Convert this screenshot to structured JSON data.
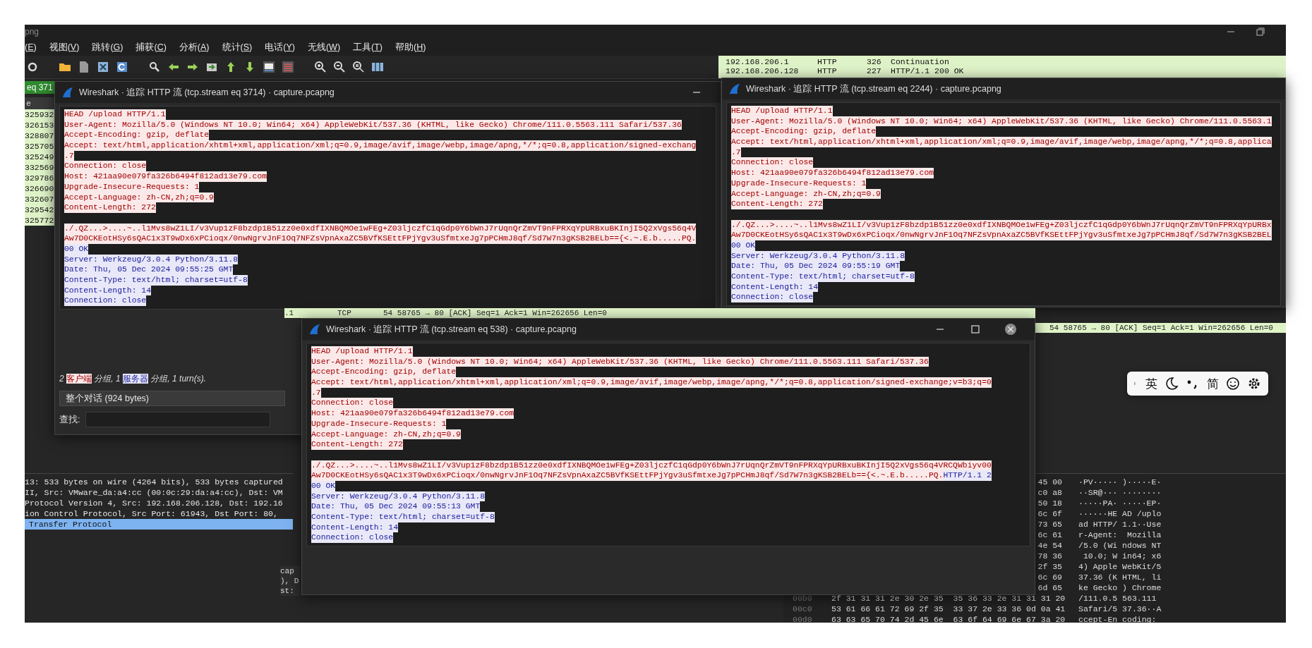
{
  "main_window": {
    "title": "png",
    "menu": [
      "(E)",
      "视图(V)",
      "跳转(G)",
      "捕获(C)",
      "分析(A)",
      "统计(S)",
      "电话(Y)",
      "无线(W)",
      "工具(T)",
      "帮助(H)"
    ],
    "packet_rows": [
      {
        "source": "192.168.206.1",
        "protocol": "HTTP",
        "length": "326",
        "info": "Continuation"
      },
      {
        "source": "192.168.206.128",
        "protocol": "HTTP",
        "length": "227",
        "info": "HTTP/1.1 200 OK"
      }
    ],
    "filter": "eq 371",
    "packet_numbers": {
      "header": "e",
      "rows": [
        "325932",
        "326153",
        "328807",
        "325705",
        "325249",
        "332569",
        "329786",
        "326690",
        "332607",
        "329542",
        "325772"
      ]
    },
    "ack_rows": [
      {
        "column_1": ".1",
        "protocol": "TCP",
        "info": "54 58765 → 80 [ACK] Seq=1 Ack=1 Win=262656 Len=0"
      },
      {
        "info": "54 58765 → 80 [ACK] Seq=1 Ack=1 Win=262656 Len=0"
      }
    ],
    "details": [
      {
        "text": "13: 533 bytes on wire (4264 bits), 533 bytes captured",
        "selected": false
      },
      {
        "text": "II, Src: VMware_da:a4:cc (00:0c:29:da:a4:cc), Dst: VM",
        "selected": false
      },
      {
        "text": "Protocol Version 4, Src: 192.168.206.128, Dst: 192.16",
        "selected": false
      },
      {
        "text": "ion Control Protocol, Src Port: 61943, Dst Port: 80,",
        "selected": false
      },
      {
        "text": "Transfer Protocol",
        "selected": true
      }
    ],
    "details_fragments": [
      "cap",
      "), D",
      "st:"
    ],
    "hex_rows": [
      {
        "hex": "45 00",
        "ascii": "·PV····· )·····E·"
      },
      {
        "hex": "c0 a8",
        "ascii": "··SR@··· ········"
      },
      {
        "hex": "50 18",
        "ascii": "·····PA· ·····EP·"
      },
      {
        "hex": "6c 6f",
        "ascii": "······HE AD /uplo"
      },
      {
        "hex": "73 65",
        "ascii": "ad HTTP/ 1.1··Use"
      },
      {
        "hex": "6c 61",
        "ascii": "r-Agent:  Mozilla"
      },
      {
        "hex": "4e 54",
        "ascii": "/5.0 (Wi ndows NT"
      },
      {
        "hex": "78 36",
        "ascii": " 10.0; W in64; x6"
      },
      {
        "hex": "2f 35",
        "ascii": "4) Apple WebKit/5"
      },
      {
        "hex": "6c 69",
        "ascii": "37.36 (K HTML, li"
      },
      {
        "hex": "6d 65",
        "ascii": "ke Gecko ) Chrome"
      },
      {
        "offset": "00b0",
        "hex": "2f 31 31 31 2e 30 2e 35  35 36 33 2e 31 31 31 20",
        "ascii": "/111.0.5 563.111"
      },
      {
        "offset": "00c0",
        "hex": "53 61 66 61 72 69 2f 35  33 37 2e 33 36 0d 0a 41",
        "ascii": "Safari/5 37.36··A"
      },
      {
        "offset": "00d0",
        "hex": "63 63 65 70 74 2d 45 6e  63 6f 64 69 6e 67 3a 20",
        "ascii": "ccept-En coding:"
      }
    ]
  },
  "stream_windows": [
    {
      "title": "Wireshark · 追踪 HTTP 流 (tcp.stream eq 3714) · capture.pcapng",
      "controls": [
        {
          "kind": "minimize"
        }
      ],
      "lines": [
        {
          "parts": [
            {
              "kind": "request",
              "text": "HEAD /upload HTTP/1.1"
            }
          ]
        },
        {
          "parts": [
            {
              "kind": "request",
              "text": "User-Agent: Mozilla/5.0 (Windows NT 10.0; Win64; x64) AppleWebKit/537.36 (KHTML, like Gecko) Chrome/111.0.5563.111 Safari/537.36"
            }
          ]
        },
        {
          "parts": [
            {
              "kind": "request",
              "text": "Accept-Encoding: gzip, deflate"
            }
          ]
        },
        {
          "parts": [
            {
              "kind": "request",
              "text": "Accept: text/html,application/xhtml+xml,application/xml;q=0.9,image/avif,image/webp,image/apng,*/*;q=0.8,application/signed-exchang"
            }
          ]
        },
        {
          "parts": [
            {
              "kind": "request",
              "text": ".7"
            }
          ]
        },
        {
          "parts": [
            {
              "kind": "request",
              "text": "Connection: close"
            }
          ]
        },
        {
          "parts": [
            {
              "kind": "request",
              "text": "Host: 421aa90e079fa326b6494f812ad13e79.com"
            }
          ]
        },
        {
          "parts": [
            {
              "kind": "request",
              "text": "Upgrade-Insecure-Requests: 1"
            }
          ]
        },
        {
          "parts": [
            {
              "kind": "request",
              "text": "Accept-Language: zh-CN,zh;q=0.9"
            }
          ]
        },
        {
          "parts": [
            {
              "kind": "request",
              "text": "Content-Length: 272"
            }
          ]
        },
        {
          "gap_before": true,
          "parts": [
            {
              "kind": "request",
              "text": "./.QZ...>....~..l1Mvs8wZ1LI/v3Vup1zF8bzdp1B51zz0e0xdfIXNBQMOe1wFEg+Z03ljczfC1qGdp0Y6bWnJ7rUqnQrZmVT9nFPRXqYpURBxuBKInjI5Q2xVgs56q4V"
            }
          ]
        },
        {
          "parts": [
            {
              "kind": "request",
              "text": "Aw7D0CKEotHSy6sQAC1x3T9wDx6xPCioqx/0nwNgrvJnF1Oq7NFZsVpnAxaZC5BVfKSEttFPjYgv3uSfmtxeJg7pPCHmJ8qf/Sd7W7n3gKSB2BELb=={<.~.E.b.....PQ."
            }
          ]
        },
        {
          "parts": [
            {
              "kind": "response",
              "text": "00 OK"
            }
          ]
        },
        {
          "parts": [
            {
              "kind": "response",
              "text": "Server: Werkzeug/3.0.4 Python/3.11.8"
            }
          ]
        },
        {
          "parts": [
            {
              "kind": "response",
              "text": "Date: Thu, 05 Dec 2024 09:55:25 GMT"
            }
          ]
        },
        {
          "parts": [
            {
              "kind": "response",
              "text": "Content-Type: text/html; charset=utf-8"
            }
          ]
        },
        {
          "parts": [
            {
              "kind": "response",
              "text": "Content-Length: 14"
            }
          ]
        },
        {
          "parts": [
            {
              "kind": "response",
              "text": "Connection: close"
            }
          ]
        }
      ],
      "footer": {
        "summary": [
          {
            "text": "2 "
          },
          {
            "kind": "request",
            "text": "客户端"
          },
          {
            "text": " 分组, 1 "
          },
          {
            "kind": "response",
            "text": "服务器"
          },
          {
            "text": " 分组, 1 turn(s)."
          }
        ],
        "conversation": "整个对话 (924 bytes)",
        "find_label": "查找:"
      }
    },
    {
      "title": "Wireshark · 追踪 HTTP 流 (tcp.stream eq 2244) · capture.pcapng",
      "lines": [
        {
          "parts": [
            {
              "kind": "request",
              "text": "HEAD /upload HTTP/1.1"
            }
          ]
        },
        {
          "parts": [
            {
              "kind": "request",
              "text": "User-Agent: Mozilla/5.0 (Windows NT 10.0; Win64; x64) AppleWebKit/537.36 (KHTML, like Gecko) Chrome/111.0.5563.1"
            }
          ]
        },
        {
          "parts": [
            {
              "kind": "request",
              "text": "Accept-Encoding: gzip, deflate"
            }
          ]
        },
        {
          "parts": [
            {
              "kind": "request",
              "text": "Accept: text/html,application/xhtml+xml,application/xml;q=0.9,image/avif,image/webp,image/apng,*/*;q=0.8,applica"
            }
          ]
        },
        {
          "parts": [
            {
              "kind": "request",
              "text": ".7"
            }
          ]
        },
        {
          "parts": [
            {
              "kind": "request",
              "text": "Connection: close"
            }
          ]
        },
        {
          "parts": [
            {
              "kind": "request",
              "text": "Host: 421aa90e079fa326b6494f812ad13e79.com"
            }
          ]
        },
        {
          "parts": [
            {
              "kind": "request",
              "text": "Upgrade-Insecure-Requests: 1"
            }
          ]
        },
        {
          "parts": [
            {
              "kind": "request",
              "text": "Accept-Language: zh-CN,zh;q=0.9"
            }
          ]
        },
        {
          "parts": [
            {
              "kind": "request",
              "text": "Content-Length: 272"
            }
          ]
        },
        {
          "gap_before": true,
          "parts": [
            {
              "kind": "request",
              "text": "./.QZ...>....~..l1Mvs8wZ1LI/v3Vup1zF8bzdp1B51zz0e0xdfIXNBQMOe1wFEg+Z03ljczfC1qGdp0Y6bWnJ7rUqnQrZmVT9nFPRXqYpURBx"
            }
          ]
        },
        {
          "parts": [
            {
              "kind": "request",
              "text": "Aw7D0CKEotHSy6sQAC1x3T9wDx6xPCioqx/0nwNgrvJnF1Oq7NFZsVpnAxaZC5BVfKSEttFPjYgv3uSfmtxeJg7pPCHmJ8qf/Sd7W7n3gKSB2BEL"
            }
          ]
        },
        {
          "parts": [
            {
              "kind": "response",
              "text": "00 OK"
            }
          ]
        },
        {
          "parts": [
            {
              "kind": "response",
              "text": "Server: Werkzeug/3.0.4 Python/3.11.8"
            }
          ]
        },
        {
          "parts": [
            {
              "kind": "response",
              "text": "Date: Thu, 05 Dec 2024 09:55:19 GMT"
            }
          ]
        },
        {
          "parts": [
            {
              "kind": "response",
              "text": "Content-Type: text/html; charset=utf-8"
            }
          ]
        },
        {
          "parts": [
            {
              "kind": "response",
              "text": "Content-Length: 14"
            }
          ]
        },
        {
          "parts": [
            {
              "kind": "response",
              "text": "Connection: close"
            }
          ]
        }
      ]
    },
    {
      "title": "Wireshark · 追踪 HTTP 流 (tcp.stream eq 538) · capture.pcapng",
      "controls": [
        {
          "kind": "minimize"
        },
        {
          "kind": "maximize"
        },
        {
          "kind": "close"
        }
      ],
      "lines": [
        {
          "parts": [
            {
              "kind": "request",
              "text": "HEAD /upload HTTP/1.1"
            }
          ]
        },
        {
          "parts": [
            {
              "kind": "request",
              "text": "User-Agent: Mozilla/5.0 (Windows NT 10.0; Win64; x64) AppleWebKit/537.36 (KHTML, like Gecko) Chrome/111.0.5563.111 Safari/537.36"
            }
          ]
        },
        {
          "parts": [
            {
              "kind": "request",
              "text": "Accept-Encoding: gzip, deflate"
            }
          ]
        },
        {
          "parts": [
            {
              "kind": "request",
              "text": "Accept: text/html,application/xhtml+xml,application/xml;q=0.9,image/avif,image/webp,image/apng,*/*;q=0.8,application/signed-exchange;v=b3;q=0"
            }
          ]
        },
        {
          "parts": [
            {
              "kind": "request",
              "text": ".7"
            }
          ]
        },
        {
          "parts": [
            {
              "kind": "request",
              "text": "Connection: close"
            }
          ]
        },
        {
          "parts": [
            {
              "kind": "request",
              "text": "Host: 421aa90e079fa326b6494f812ad13e79.com"
            }
          ]
        },
        {
          "parts": [
            {
              "kind": "request",
              "text": "Upgrade-Insecure-Requests: 1"
            }
          ]
        },
        {
          "parts": [
            {
              "kind": "request",
              "text": "Accept-Language: zh-CN,zh;q=0.9"
            }
          ]
        },
        {
          "parts": [
            {
              "kind": "request",
              "text": "Content-Length: 272"
            }
          ]
        },
        {
          "gap_before": true,
          "parts": [
            {
              "kind": "request",
              "text": "./.QZ...>....~..l1Mvs8wZ1LI/v3Vup1zF8bzdp1B51zz0e0xdfIXNBQMOe1wFEg+Z03ljczfC1qGdp0Y6bWnJ7rUqnQrZmVT9nFPRXqYpURBxuBKInjI5Q2xVgs56q4VRCQWbiyv00"
            }
          ]
        },
        {
          "parts": [
            {
              "kind": "request",
              "text": "Aw7D0CKEotHSy6sQAC1x3T9wDx6xPCioqx/0nwNgrvJnF1Oq7NFZsVpnAxaZC5BVfKSEttFPjYgv3uSfmtxeJg7pPCHmJ8qf/Sd7W7n3gKSB2BELb=={<.~.E.b.....PQ."
            },
            {
              "kind": "response",
              "text": "HTTP/1.1 2"
            }
          ]
        },
        {
          "parts": [
            {
              "kind": "response",
              "text": "00 OK"
            }
          ]
        },
        {
          "parts": [
            {
              "kind": "response",
              "text": "Server: Werkzeug/3.0.4 Python/3.11.8"
            }
          ]
        },
        {
          "parts": [
            {
              "kind": "response",
              "text": "Date: Thu, 05 Dec 2024 09:55:13 GMT"
            }
          ]
        },
        {
          "parts": [
            {
              "kind": "response",
              "text": "Content-Type: text/html; charset=utf-8"
            }
          ]
        },
        {
          "parts": [
            {
              "kind": "response",
              "text": "Content-Length: 14"
            }
          ]
        },
        {
          "parts": [
            {
              "kind": "response",
              "text": "Connection: close"
            }
          ]
        }
      ]
    }
  ],
  "ime_bar": [
    {
      "kind": "caret"
    },
    {
      "kind": "text",
      "label": "英"
    },
    {
      "kind": "moon"
    },
    {
      "kind": "punctuation"
    },
    {
      "kind": "text",
      "label": "简"
    },
    {
      "kind": "smiley"
    },
    {
      "kind": "gear"
    }
  ]
}
